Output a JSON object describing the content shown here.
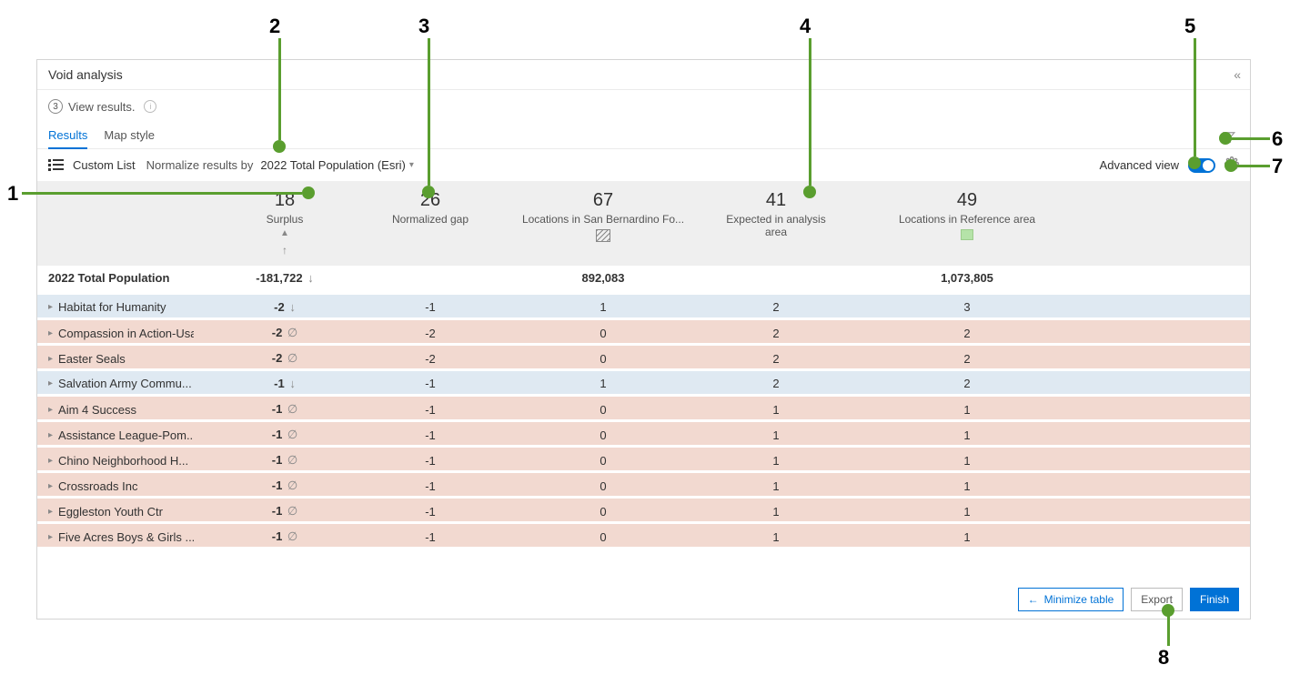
{
  "panel": {
    "title": "Void analysis"
  },
  "step": {
    "number": "3",
    "label": "View results."
  },
  "tabs": {
    "results": "Results",
    "mapstyle": "Map style"
  },
  "toolbar": {
    "custom_list": "Custom List",
    "normalize_label": "Normalize results by",
    "normalize_value": "2022 Total Population (Esri)",
    "advanced_view_label": "Advanced view"
  },
  "columns": {
    "surplus": {
      "value": "18",
      "label": "Surplus"
    },
    "normgap": {
      "value": "26",
      "label": "Normalized gap"
    },
    "locs_analysis": {
      "value": "67",
      "label": "Locations in San Bernardino Fo..."
    },
    "expected": {
      "value": "41",
      "label": "Expected in analysis area"
    },
    "locs_reference": {
      "value": "49",
      "label": "Locations in Reference area"
    }
  },
  "totals": {
    "name": "2022 Total Population",
    "surplus": "-181,722",
    "locs_analysis": "892,083",
    "locs_reference": "1,073,805"
  },
  "rows": [
    {
      "name": "Habitat for Humanity",
      "surplus": "-2",
      "icon": "down",
      "normgap": "-1",
      "loc_an": "1",
      "exp": "2",
      "loc_ref": "3",
      "band": "blue"
    },
    {
      "name": "Compassion in Action-Usa",
      "surplus": "-2",
      "icon": "empty",
      "normgap": "-2",
      "loc_an": "0",
      "exp": "2",
      "loc_ref": "2",
      "band": "pink"
    },
    {
      "name": "Easter Seals",
      "surplus": "-2",
      "icon": "empty",
      "normgap": "-2",
      "loc_an": "0",
      "exp": "2",
      "loc_ref": "2",
      "band": "pink"
    },
    {
      "name": "Salvation Army Commu...",
      "surplus": "-1",
      "icon": "down",
      "normgap": "-1",
      "loc_an": "1",
      "exp": "2",
      "loc_ref": "2",
      "band": "blue"
    },
    {
      "name": "Aim 4 Success",
      "surplus": "-1",
      "icon": "empty",
      "normgap": "-1",
      "loc_an": "0",
      "exp": "1",
      "loc_ref": "1",
      "band": "pink"
    },
    {
      "name": "Assistance League-Pom...",
      "surplus": "-1",
      "icon": "empty",
      "normgap": "-1",
      "loc_an": "0",
      "exp": "1",
      "loc_ref": "1",
      "band": "pink"
    },
    {
      "name": "Chino Neighborhood H...",
      "surplus": "-1",
      "icon": "empty",
      "normgap": "-1",
      "loc_an": "0",
      "exp": "1",
      "loc_ref": "1",
      "band": "pink"
    },
    {
      "name": "Crossroads Inc",
      "surplus": "-1",
      "icon": "empty",
      "normgap": "-1",
      "loc_an": "0",
      "exp": "1",
      "loc_ref": "1",
      "band": "pink"
    },
    {
      "name": "Eggleston Youth Ctr",
      "surplus": "-1",
      "icon": "empty",
      "normgap": "-1",
      "loc_an": "0",
      "exp": "1",
      "loc_ref": "1",
      "band": "pink"
    },
    {
      "name": "Five Acres Boys & Girls ...",
      "surplus": "-1",
      "icon": "empty",
      "normgap": "-1",
      "loc_an": "0",
      "exp": "1",
      "loc_ref": "1",
      "band": "pink"
    }
  ],
  "footer": {
    "minimize": "Minimize table",
    "export": "Export",
    "finish": "Finish"
  },
  "callouts": {
    "1": "1",
    "2": "2",
    "3": "3",
    "4": "4",
    "5": "5",
    "6": "6",
    "7": "7",
    "8": "8"
  }
}
